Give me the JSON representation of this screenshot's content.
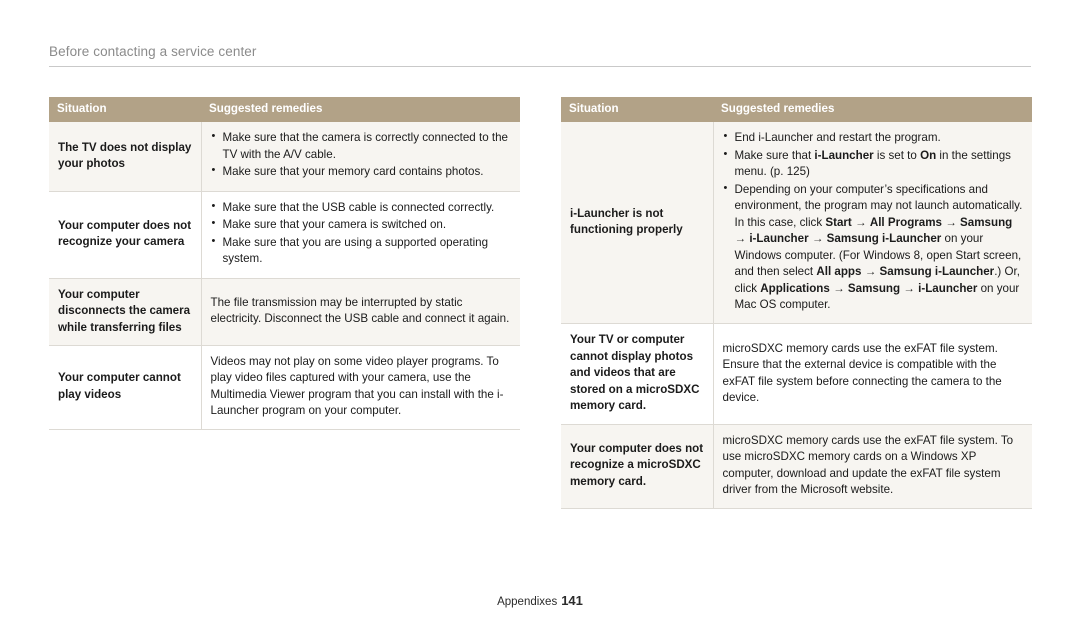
{
  "header": {
    "title": "Before contacting a service center"
  },
  "tables": {
    "columns": [
      "Situation",
      "Suggested remedies"
    ],
    "left": [
      {
        "situation": "The TV does not display your photos",
        "remedy_type": "bullets",
        "remedies": [
          "Make sure that the camera is correctly connected to the TV with the A/V cable.",
          "Make sure that your memory card contains photos."
        ]
      },
      {
        "situation": "Your computer does not recognize your camera",
        "remedy_type": "bullets",
        "remedies": [
          "Make sure that the USB cable is connected correctly.",
          "Make sure that your camera is switched on.",
          "Make sure that you are using a supported operating system."
        ]
      },
      {
        "situation": "Your computer disconnects the camera while transferring files",
        "remedy_type": "paragraph",
        "remedies": [
          "The file transmission may be interrupted by static electricity. Disconnect the USB cable and connect it again."
        ]
      },
      {
        "situation": "Your computer cannot play videos",
        "remedy_type": "paragraph",
        "remedies": [
          "Videos may not play on some video player programs. To play video files captured with your camera, use the Multimedia Viewer program that you can install with the i-Launcher program on your computer."
        ]
      }
    ],
    "right": [
      {
        "situation": "i-Launcher is not functioning properly",
        "remedy_type": "bullets_rich",
        "remedies_html": [
          "End i-Launcher and restart the program.",
          "Make sure that <b>i-Launcher</b> is set to <b>On</b> in the settings menu. (p. 125)",
          "Depending on your computer’s specifications and environment, the program may not launch automatically. In this case, click <b>Start</b> → <b>All Programs</b> → <b>Samsung</b> → <b>i-Launcher</b> → <b>Samsung i-Launcher</b> on your Windows computer. (For Windows 8, open Start screen, and then select <b>All apps</b> → <b>Samsung i-Launcher</b>.) Or, click <b>Applications</b> → <b>Samsung</b> → <b>i-Launcher</b> on your Mac OS computer."
        ]
      },
      {
        "situation": "Your TV or computer cannot display photos and videos that are stored on a microSDXC memory card.",
        "remedy_type": "paragraph",
        "remedies": [
          "microSDXC memory cards use the exFAT file system. Ensure that the external device is compatible with the exFAT file system before connecting the camera to the device."
        ]
      },
      {
        "situation": "Your computer does not recognize a microSDXC memory card.",
        "remedy_type": "paragraph",
        "remedies": [
          "microSDXC memory cards use the exFAT file system. To use microSDXC memory cards on a Windows XP computer, download and update the exFAT file system driver from the Microsoft website."
        ]
      }
    ]
  },
  "footer": {
    "section": "Appendixes",
    "page_number": "141"
  },
  "colors": {
    "header_band": "#b2a287",
    "row_shade": "#f7f5f1",
    "rule": "#c9c9c9",
    "title_text": "#8b8b8b"
  }
}
